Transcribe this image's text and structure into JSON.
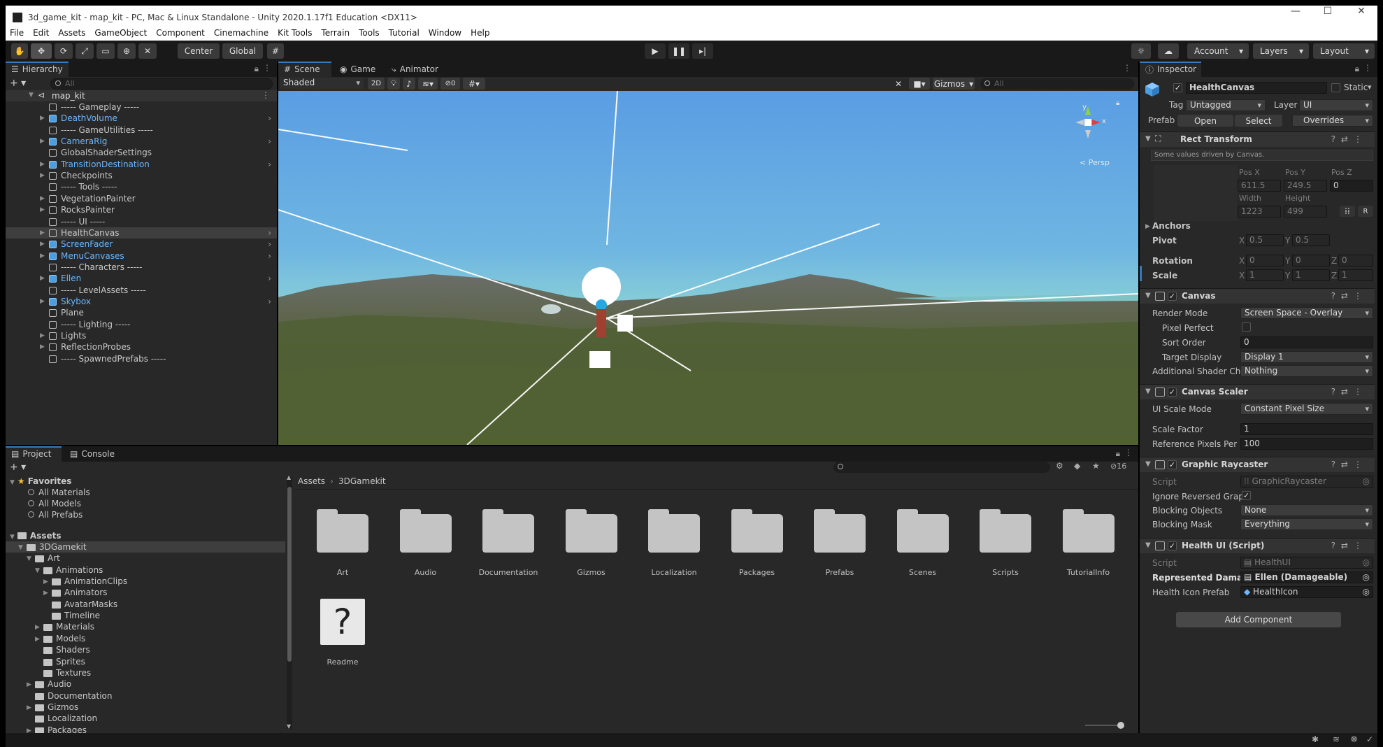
{
  "window": {
    "title": "3d_game_kit - map_kit - PC, Mac & Linux Standalone - Unity 2020.1.17f1 Education <DX11>",
    "controls": [
      "—",
      "☐",
      "✕"
    ]
  },
  "menu": [
    "File",
    "Edit",
    "Assets",
    "GameObject",
    "Component",
    "Cinemachine",
    "Kit Tools",
    "Terrain",
    "Tools",
    "Tutorial",
    "Window",
    "Help"
  ],
  "toolbar": {
    "center_label": "Center",
    "global_label": "Global",
    "account_label": "Account",
    "layers_label": "Layers",
    "layout_label": "Layout"
  },
  "hierarchy": {
    "tab": "Hierarchy",
    "search_placeholder": "All",
    "scene_name": "map_kit",
    "items": [
      {
        "label": "----- Gameplay -----",
        "blue": false
      },
      {
        "label": "DeathVolume",
        "blue": true
      },
      {
        "label": "----- GameUtilities -----",
        "blue": false
      },
      {
        "label": "CameraRig",
        "blue": true
      },
      {
        "label": "GlobalShaderSettings",
        "blue": false
      },
      {
        "label": "TransitionDestination",
        "blue": true
      },
      {
        "label": "Checkpoints",
        "blue": false
      },
      {
        "label": "----- Tools -----",
        "blue": false
      },
      {
        "label": "VegetationPainter",
        "blue": false
      },
      {
        "label": "RocksPainter",
        "blue": false
      },
      {
        "label": "----- UI -----",
        "blue": false
      },
      {
        "label": "HealthCanvas",
        "blue": false
      },
      {
        "label": "ScreenFader",
        "blue": true
      },
      {
        "label": "MenuCanvases",
        "blue": true
      },
      {
        "label": "----- Characters -----",
        "blue": false
      },
      {
        "label": "Ellen",
        "blue": true
      },
      {
        "label": "----- LevelAssets -----",
        "blue": false
      },
      {
        "label": "Skybox",
        "blue": true
      },
      {
        "label": "Plane",
        "blue": false
      },
      {
        "label": "----- Lighting -----",
        "blue": false
      },
      {
        "label": "Lights",
        "blue": false
      },
      {
        "label": "ReflectionProbes",
        "blue": false
      },
      {
        "label": "----- SpawnedPrefabs -----",
        "blue": false
      }
    ]
  },
  "scene": {
    "tabs": [
      "Scene",
      "Game",
      "Animator"
    ],
    "shading": "Shaded",
    "mode_2d": "2D",
    "hidden_count": "0",
    "gizmos": "Gizmos",
    "search_placeholder": "All",
    "persp": "< Persp",
    "axes": {
      "y": "y",
      "x": "x"
    }
  },
  "project": {
    "tabs": [
      "Project",
      "Console"
    ],
    "favorites_label": "Favorites",
    "favorites": [
      "All Materials",
      "All Models",
      "All Prefabs"
    ],
    "assets_label": "Assets",
    "tree": [
      {
        "label": "3DGamekit",
        "depth": 1
      },
      {
        "label": "Art",
        "depth": 2
      },
      {
        "label": "Animations",
        "depth": 3
      },
      {
        "label": "AnimationClips",
        "depth": 4
      },
      {
        "label": "Animators",
        "depth": 4
      },
      {
        "label": "AvatarMasks",
        "depth": 4
      },
      {
        "label": "Timeline",
        "depth": 4
      },
      {
        "label": "Materials",
        "depth": 3
      },
      {
        "label": "Models",
        "depth": 3
      },
      {
        "label": "Shaders",
        "depth": 3
      },
      {
        "label": "Sprites",
        "depth": 3
      },
      {
        "label": "Textures",
        "depth": 3
      },
      {
        "label": "Audio",
        "depth": 2
      },
      {
        "label": "Documentation",
        "depth": 2
      },
      {
        "label": "Gizmos",
        "depth": 2
      },
      {
        "label": "Localization",
        "depth": 2
      },
      {
        "label": "Packages",
        "depth": 2
      }
    ],
    "breadcrumb": [
      "Assets",
      "3DGamekit"
    ],
    "hidden_count": "16",
    "folders": [
      "Art",
      "Audio",
      "Documentation",
      "Gizmos",
      "Localization",
      "Packages",
      "Prefabs",
      "Scenes",
      "Scripts",
      "TutorialInfo"
    ],
    "readme": "Readme"
  },
  "inspector": {
    "tab": "Inspector",
    "object_name": "HealthCanvas",
    "static_label": "Static",
    "tag_label": "Tag",
    "tag_value": "Untagged",
    "layer_label": "Layer",
    "layer_value": "UI",
    "prefab_label": "Prefab",
    "open_label": "Open",
    "select_label": "Select",
    "overrides_label": "Overrides",
    "rect_transform": {
      "title": "Rect Transform",
      "note": "Some values driven by Canvas.",
      "pos_x_label": "Pos X",
      "pos_y_label": "Pos Y",
      "pos_z_label": "Pos Z",
      "pos_x": "611.5",
      "pos_y": "249.5",
      "pos_z": "0",
      "width_label": "Width",
      "height_label": "Height",
      "width": "1223",
      "height": "499",
      "anchors_label": "Anchors",
      "pivot_label": "Pivot",
      "pivot_x": "0.5",
      "pivot_y": "0.5",
      "rotation_label": "Rotation",
      "rot_x": "0",
      "rot_y": "0",
      "rot_z": "0",
      "scale_label": "Scale",
      "scale_x": "1",
      "scale_y": "1",
      "scale_z": "1",
      "r_button": "R"
    },
    "canvas": {
      "title": "Canvas",
      "render_mode_label": "Render Mode",
      "render_mode": "Screen Space - Overlay",
      "pixel_perfect_label": "Pixel Perfect",
      "sort_order_label": "Sort Order",
      "sort_order": "0",
      "target_display_label": "Target Display",
      "target_display": "Display 1",
      "shader_ch_label": "Additional Shader Ch",
      "shader_ch": "Nothing"
    },
    "canvas_scaler": {
      "title": "Canvas Scaler",
      "ui_scale_mode_label": "UI Scale Mode",
      "ui_scale_mode": "Constant Pixel Size",
      "scale_factor_label": "Scale Factor",
      "scale_factor": "1",
      "ref_pixels_label": "Reference Pixels Per",
      "ref_pixels": "100"
    },
    "graphic_raycaster": {
      "title": "Graphic Raycaster",
      "script_label": "Script",
      "script": "GraphicRaycaster",
      "ignore_reversed_label": "Ignore Reversed Grap",
      "blocking_objects_label": "Blocking Objects",
      "blocking_objects": "None",
      "blocking_mask_label": "Blocking Mask",
      "blocking_mask": "Everything"
    },
    "health_ui": {
      "title": "Health UI (Script)",
      "script_label": "Script",
      "script": "HealthUI",
      "represented_label": "Represented Damag",
      "represented": "Ellen (Damageable)",
      "icon_prefab_label": "Health Icon Prefab",
      "icon_prefab": "HealthIcon"
    },
    "add_component": "Add Component"
  },
  "colors": {
    "accent": "#3a79bb",
    "blue_text": "#6ab7ff",
    "panel": "#282828",
    "sky_top": "#5a9de3",
    "sky_bottom": "#8ad0d6"
  }
}
